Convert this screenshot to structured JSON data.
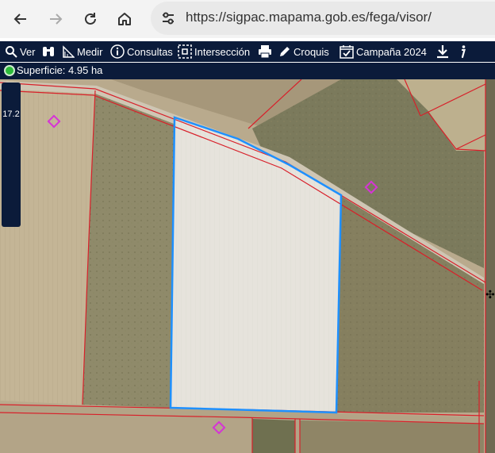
{
  "browser": {
    "url": "https://sigpac.mapama.gob.es/fega/visor/"
  },
  "toolbar": {
    "ver": "Ver",
    "medir": "Medir",
    "consultas": "Consultas",
    "interseccion": "Intersección",
    "croquis": "Croquis",
    "campana": "Campaña 2024"
  },
  "status": {
    "superficie": "Superficie: 4.95 ha",
    "indicator_color": "#2dbb3a"
  },
  "map": {
    "zoom_value": "17.2",
    "parcel_outline_color": "#1e90ff",
    "boundary_color": "#d8202a",
    "marker_color": "#d633d6"
  }
}
